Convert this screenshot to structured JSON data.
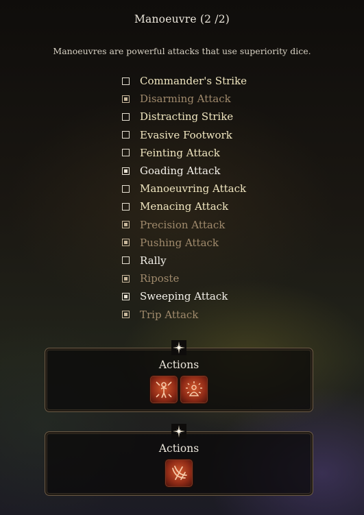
{
  "header": {
    "title": "Manoeuvre  (2 /2)",
    "description": "Manoeuvres are powerful attacks that use superiority dice."
  },
  "manoeuvres": [
    {
      "label": "Commander's Strike",
      "checked": false,
      "state": "available"
    },
    {
      "label": "Disarming Attack",
      "checked": true,
      "state": "unavailable"
    },
    {
      "label": "Distracting Strike",
      "checked": false,
      "state": "available"
    },
    {
      "label": "Evasive Footwork",
      "checked": false,
      "state": "available"
    },
    {
      "label": "Feinting Attack",
      "checked": false,
      "state": "available"
    },
    {
      "label": "Goading Attack",
      "checked": true,
      "state": "selected"
    },
    {
      "label": "Manoeuvring Attack",
      "checked": false,
      "state": "available"
    },
    {
      "label": "Menacing Attack",
      "checked": false,
      "state": "available"
    },
    {
      "label": "Precision Attack",
      "checked": true,
      "state": "unavailable"
    },
    {
      "label": "Pushing Attack",
      "checked": true,
      "state": "unavailable"
    },
    {
      "label": "Rally",
      "checked": false,
      "state": "selected"
    },
    {
      "label": "Riposte",
      "checked": true,
      "state": "unavailable"
    },
    {
      "label": "Sweeping Attack",
      "checked": true,
      "state": "selected"
    },
    {
      "label": "Trip Attack",
      "checked": true,
      "state": "unavailable"
    }
  ],
  "panels": [
    {
      "title": "Actions",
      "icons": [
        "goading-attack-icon",
        "rally-icon"
      ]
    },
    {
      "title": "Actions",
      "icons": [
        "sweeping-attack-icon"
      ]
    }
  ],
  "colors": {
    "available": "#f0e6c0",
    "selected": "#f4f1ea",
    "unavailable": "#a08a6c",
    "icon_red": "#d1582d",
    "panel_border": "#6b5a45"
  }
}
